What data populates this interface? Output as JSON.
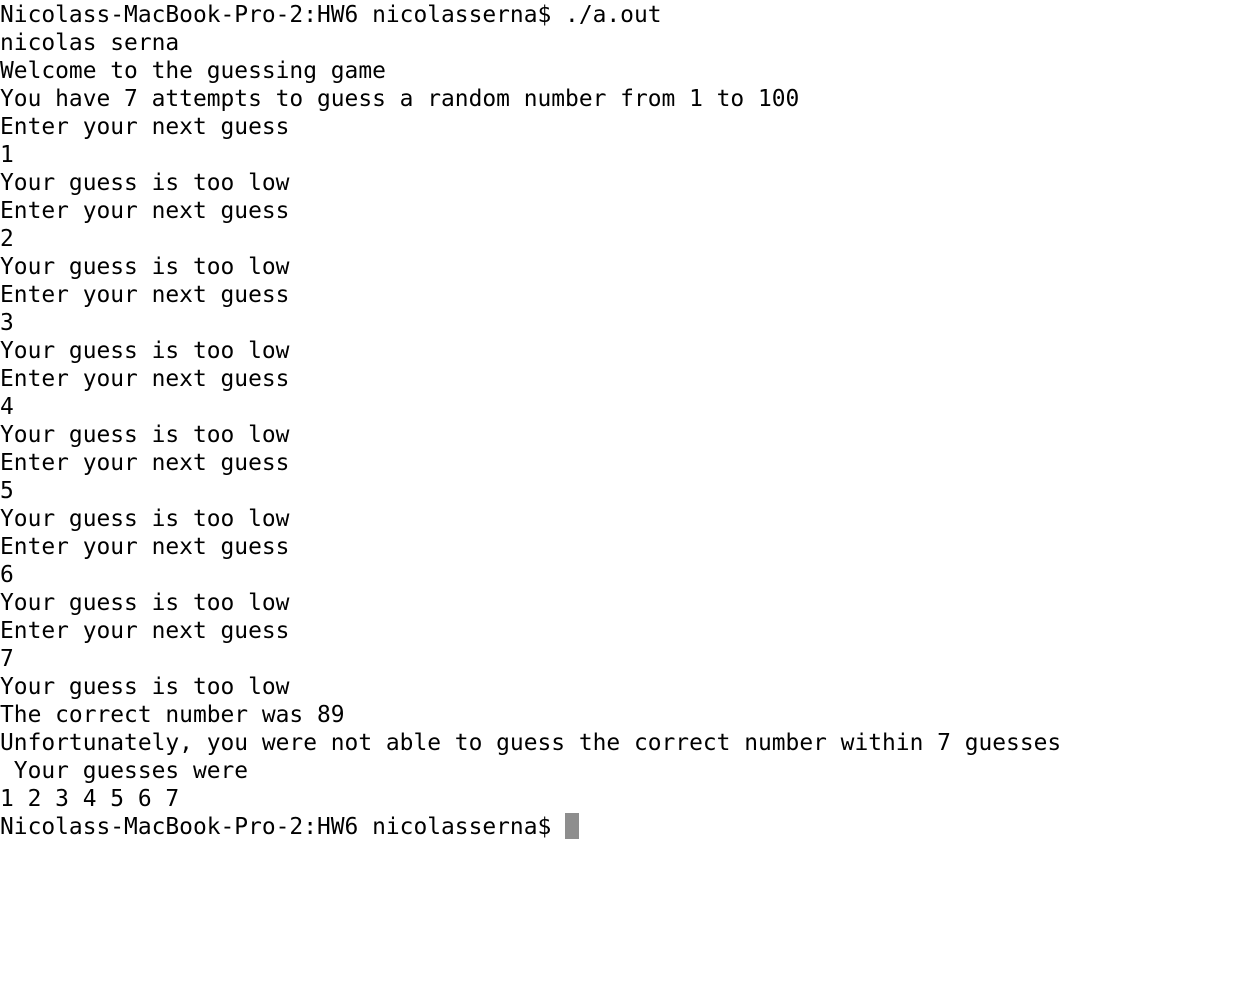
{
  "terminal": {
    "lines": [
      "Nicolass-MacBook-Pro-2:HW6 nicolasserna$ ./a.out",
      "nicolas serna",
      "Welcome to the guessing game",
      "You have 7 attempts to guess a random number from 1 to 100",
      "Enter your next guess",
      "1",
      "Your guess is too low",
      "Enter your next guess",
      "2",
      "Your guess is too low",
      "Enter your next guess",
      "3",
      "Your guess is too low",
      "Enter your next guess",
      "4",
      "Your guess is too low",
      "Enter your next guess",
      "5",
      "Your guess is too low",
      "Enter your next guess",
      "6",
      "Your guess is too low",
      "Enter your next guess",
      "7",
      "Your guess is too low",
      "The correct number was 89",
      "Unfortunately, you were not able to guess the correct number within 7 guesses",
      " Your guesses were",
      "1 2 3 4 5 6 7"
    ],
    "prompt": "Nicolass-MacBook-Pro-2:HW6 nicolasserna$ ",
    "colors": {
      "background": "#ffffff",
      "text": "#000000",
      "cursor": "#8e8e8e"
    }
  }
}
